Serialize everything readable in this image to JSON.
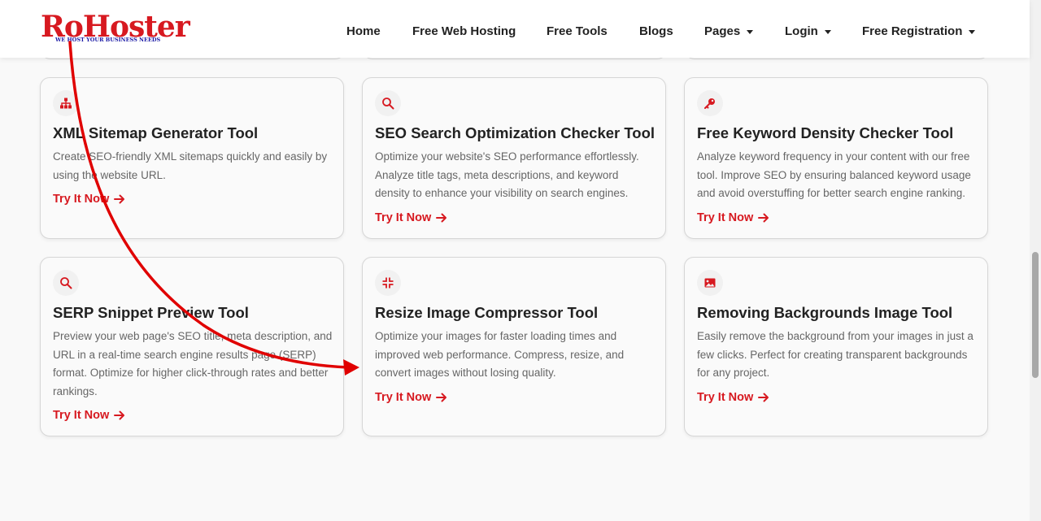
{
  "logo": {
    "name": "RoHoster",
    "tagline": "WE HOST YOUR BUSINESS NEEDS"
  },
  "nav": {
    "home": "Home",
    "free_web_hosting": "Free Web Hosting",
    "free_tools": "Free Tools",
    "blogs": "Blogs",
    "pages": "Pages",
    "login": "Login",
    "free_registration": "Free Registration"
  },
  "colors": {
    "accent": "#d71920",
    "text": "#222222",
    "muted": "#666666",
    "background": "#f9f9f9"
  },
  "cards": [
    {
      "icon": "sitemap-icon",
      "title": "XML Sitemap Generator Tool",
      "description": "Create SEO-friendly XML sitemaps quickly and easily by using the website URL.",
      "link": "Try It Now"
    },
    {
      "icon": "search-icon",
      "title": "SEO Search Optimization Checker Tool",
      "description": "Optimize your website's SEO performance effortlessly. Analyze title tags, meta descriptions, and keyword density to enhance your visibility on search engines.",
      "link": "Try It Now"
    },
    {
      "icon": "key-icon",
      "title": "Free Keyword Density Checker Tool",
      "description": "Analyze keyword frequency in your content with our free tool. Improve SEO by ensuring balanced keyword usage and avoid overstuffing for better search engine ranking.",
      "link": "Try It Now"
    },
    {
      "icon": "search-icon",
      "title": "SERP Snippet Preview Tool",
      "description": "Preview your web page's SEO title, meta description, and URL in a real-time search engine results page (SERP) format. Optimize for higher click-through rates and better rankings.",
      "link": "Try It Now"
    },
    {
      "icon": "compress-icon",
      "title": "Resize Image Compressor Tool",
      "description": "Optimize your images for faster loading times and improved web performance. Compress, resize, and convert images without losing quality.",
      "link": "Try It Now"
    },
    {
      "icon": "image-icon",
      "title": "Removing Backgrounds Image Tool",
      "description": "Easily remove the background from your images in just a few clicks. Perfect for creating transparent backgrounds for any project.",
      "link": "Try It Now"
    }
  ]
}
